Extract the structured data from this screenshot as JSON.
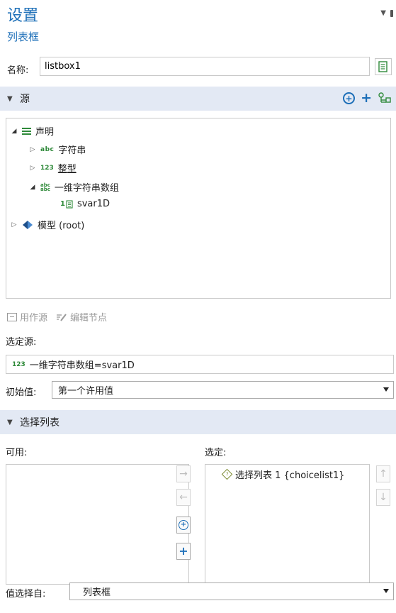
{
  "header": {
    "title": "设置",
    "subtitle": "列表框"
  },
  "name_field": {
    "label": "名称:",
    "value": "listbox1"
  },
  "source_section": {
    "title": "源",
    "tree": [
      {
        "label": "声明",
        "icon": "list-lines-icon"
      },
      {
        "label": "字符串",
        "icon": "abc-icon",
        "icon_text": "abc"
      },
      {
        "label": "整型",
        "icon": "int-icon",
        "icon_text": "123"
      },
      {
        "label": "一维字符串数组",
        "icon": "abc-array-icon",
        "icon_text_top": "abc",
        "icon_text_bottom": "abc"
      },
      {
        "label": "svar1D",
        "icon": "array-var-icon",
        "icon_text": "1"
      },
      {
        "label": "模型 (root)",
        "icon": "model-icon"
      }
    ],
    "toolbar": {
      "use_as_source": "用作源",
      "edit_node": "编辑节点"
    }
  },
  "selected_source": {
    "label": "选定源:",
    "icon_text": "123",
    "value": "一维字符串数组=svar1D"
  },
  "initial_value": {
    "label": "初始值:",
    "value": "第一个许用值"
  },
  "choice_section": {
    "title": "选择列表",
    "available_label": "可用:",
    "selected_label": "选定:",
    "selected_items": [
      {
        "label": "选择列表 1 {choicelist1}"
      }
    ]
  },
  "value_select": {
    "label": "值选择自:",
    "value": "列表框"
  },
  "colors": {
    "accent": "#1d6fb8",
    "section_bg": "#e3e9f4",
    "green": "#2f8a3a"
  }
}
